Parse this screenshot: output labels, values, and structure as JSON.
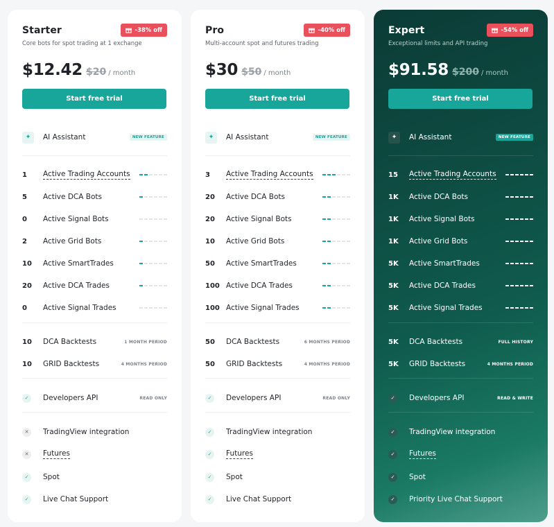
{
  "colors": {
    "accent": "#18a69a",
    "badge": "#e8505b",
    "dark_card": "#0e4d43"
  },
  "plans": [
    {
      "title": "Starter",
      "subtitle": "Core bots for spot trading at 1 exchange",
      "badge": "-38% off",
      "price": "$12.42",
      "old_price": "$20",
      "per": "/ month",
      "cta": "Start free trial",
      "ai_label": "AI Assistant",
      "ai_tag": "NEW FEATURE",
      "limits": [
        {
          "num": "1",
          "label": "Active Trading Accounts",
          "level": 2
        },
        {
          "num": "5",
          "label": "Active DCA Bots",
          "level": 1
        },
        {
          "num": "0",
          "label": "Active Signal Bots",
          "level": 0
        },
        {
          "num": "2",
          "label": "Active Grid Bots",
          "level": 1
        },
        {
          "num": "10",
          "label": "Active SmartTrades",
          "level": 1
        },
        {
          "num": "20",
          "label": "Active DCA Trades",
          "level": 1
        },
        {
          "num": "0",
          "label": "Active Signal Trades",
          "level": 0
        }
      ],
      "backtests": [
        {
          "num": "10",
          "label": "DCA Backtests",
          "note": "1 MONTH PERIOD"
        },
        {
          "num": "10",
          "label": "GRID Backtests",
          "note": "4 MONTHS PERIOD"
        }
      ],
      "api": {
        "label": "Developers API",
        "note": "READ ONLY"
      },
      "features": [
        {
          "label": "TradingView integration",
          "included": false
        },
        {
          "label": "Futures",
          "included": false
        },
        {
          "label": "Spot",
          "included": true
        },
        {
          "label": "Live Chat Support",
          "included": true
        }
      ]
    },
    {
      "title": "Pro",
      "subtitle": "Multi-account spot and futures trading",
      "badge": "-40% off",
      "price": "$30",
      "old_price": "$50",
      "per": "/ month",
      "cta": "Start free trial",
      "ai_label": "AI Assistant",
      "ai_tag": "NEW FEATURE",
      "limits": [
        {
          "num": "3",
          "label": "Active Trading Accounts",
          "level": 3
        },
        {
          "num": "20",
          "label": "Active DCA Bots",
          "level": 2
        },
        {
          "num": "20",
          "label": "Active Signal Bots",
          "level": 2
        },
        {
          "num": "10",
          "label": "Active Grid Bots",
          "level": 2
        },
        {
          "num": "50",
          "label": "Active SmartTrades",
          "level": 2
        },
        {
          "num": "100",
          "label": "Active DCA Trades",
          "level": 2
        },
        {
          "num": "100",
          "label": "Active Signal Trades",
          "level": 2
        }
      ],
      "backtests": [
        {
          "num": "50",
          "label": "DCA Backtests",
          "note": "6 MONTHS PERIOD"
        },
        {
          "num": "50",
          "label": "GRID Backtests",
          "note": "4 MONTHS PERIOD"
        }
      ],
      "api": {
        "label": "Developers API",
        "note": "READ ONLY"
      },
      "features": [
        {
          "label": "TradingView integration",
          "included": true
        },
        {
          "label": "Futures",
          "included": true
        },
        {
          "label": "Spot",
          "included": true
        },
        {
          "label": "Live Chat Support",
          "included": true
        }
      ]
    },
    {
      "title": "Expert",
      "subtitle": "Exceptional limits and API trading",
      "badge": "-54% off",
      "price": "$91.58",
      "old_price": "$200",
      "per": "/ month",
      "cta": "Start free trial",
      "ai_label": "AI Assistant",
      "ai_tag": "NEW FEATURE",
      "limits": [
        {
          "num": "15",
          "label": "Active Trading Accounts",
          "level": 6
        },
        {
          "num": "1K",
          "label": "Active DCA Bots",
          "level": 6
        },
        {
          "num": "1K",
          "label": "Active Signal Bots",
          "level": 6
        },
        {
          "num": "1K",
          "label": "Active Grid Bots",
          "level": 6
        },
        {
          "num": "5K",
          "label": "Active SmartTrades",
          "level": 6
        },
        {
          "num": "5K",
          "label": "Active DCA Trades",
          "level": 6
        },
        {
          "num": "5K",
          "label": "Active Signal Trades",
          "level": 6
        }
      ],
      "backtests": [
        {
          "num": "5K",
          "label": "DCA Backtests",
          "note": "FULL HISTORY"
        },
        {
          "num": "5K",
          "label": "GRID Backtests",
          "note": "4 MONTHS PERIOD"
        }
      ],
      "api": {
        "label": "Developers API",
        "note": "READ & WRITE"
      },
      "features": [
        {
          "label": "TradingView integration",
          "included": true
        },
        {
          "label": "Futures",
          "included": true
        },
        {
          "label": "Spot",
          "included": true
        },
        {
          "label": "Priority Live Chat Support",
          "included": true
        }
      ]
    }
  ]
}
